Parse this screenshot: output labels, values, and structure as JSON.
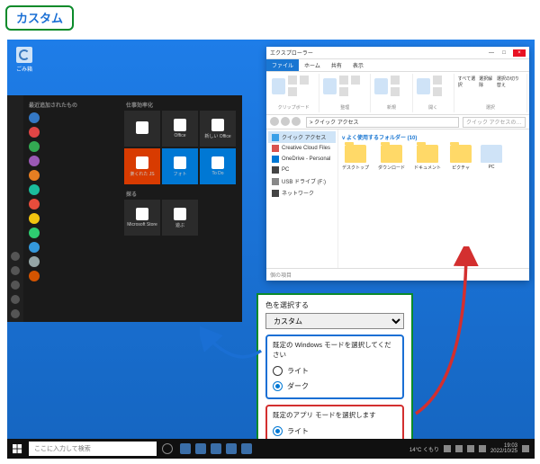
{
  "badge": {
    "label": "カスタム"
  },
  "desktop": {
    "recycle_label": "ごみ箱"
  },
  "start": {
    "recent_header": "最近追加されたもの",
    "tiles_header": "仕事効率化",
    "explore_header": "探る",
    "recent": [
      {
        "label": "",
        "color": "#3478c5"
      },
      {
        "label": "",
        "color": "#e04545"
      },
      {
        "label": "",
        "color": "#33a852"
      },
      {
        "label": "",
        "color": "#9b59b6"
      },
      {
        "label": "",
        "color": "#e67e22"
      },
      {
        "label": "",
        "color": "#1abc9c"
      },
      {
        "label": "",
        "color": "#e74c3c"
      },
      {
        "label": "",
        "color": "#f1c40f"
      },
      {
        "label": "",
        "color": "#2ecc71"
      },
      {
        "label": "",
        "color": "#3498db"
      },
      {
        "label": "",
        "color": "#95a5a6"
      },
      {
        "label": "",
        "color": "#d35400"
      }
    ],
    "tiles": [
      {
        "label": "",
        "cls": "dk"
      },
      {
        "label": "Office",
        "cls": "dk"
      },
      {
        "label": "新しい Office",
        "cls": "dk"
      },
      {
        "label": "楽くれた JS",
        "cls": "rd"
      },
      {
        "label": "フォト",
        "cls": "bl"
      },
      {
        "label": "To Do",
        "cls": "bl"
      }
    ],
    "explore": [
      {
        "label": "Microsoft Store",
        "cls": "dk"
      },
      {
        "label": "遊ぶ",
        "cls": "dk"
      }
    ]
  },
  "taskbar": {
    "search_placeholder": "ここに入力して検索",
    "weather": "14°C くもり",
    "time": "19:03",
    "date": "2022/10/25"
  },
  "explorer": {
    "title": "エクスプローラー",
    "tabs": {
      "file": "ファイル",
      "home": "ホーム",
      "share": "共有",
      "view": "表示"
    },
    "ribbon_groups": [
      "クリップボード",
      "整理",
      "新規",
      "開く",
      "選択"
    ],
    "ribbon_select": [
      "すべて選択",
      "選択解除",
      "選択の切り替え"
    ],
    "addr": "> クイック アクセス",
    "search_placeholder": "クイック アクセスの…",
    "nav": [
      {
        "label": "クイック アクセス",
        "ico": "#3aa0e8",
        "active": true
      },
      {
        "label": "Creative Cloud Files",
        "ico": "#d9534f"
      },
      {
        "label": "OneDrive - Personal",
        "ico": "#0078d4"
      },
      {
        "label": "PC",
        "ico": "#444"
      },
      {
        "label": "USB ドライブ (F:)",
        "ico": "#888"
      },
      {
        "label": "ネットワーク",
        "ico": "#444"
      }
    ],
    "folders_header": "v よく使用するフォルダー (10)",
    "folders": [
      {
        "label": "デスクトップ"
      },
      {
        "label": "ダウンロード"
      },
      {
        "label": "ドキュメント"
      },
      {
        "label": "ピクチャ"
      },
      {
        "label": "PC",
        "pc": true
      }
    ],
    "status": "個の項目"
  },
  "settings": {
    "color_label": "色を選択する",
    "color_value": "カスタム",
    "win_mode_label": "既定の Windows モードを選択してください",
    "app_mode_label": "既定のアプリ モードを選択します",
    "light": "ライト",
    "dark": "ダーク"
  }
}
